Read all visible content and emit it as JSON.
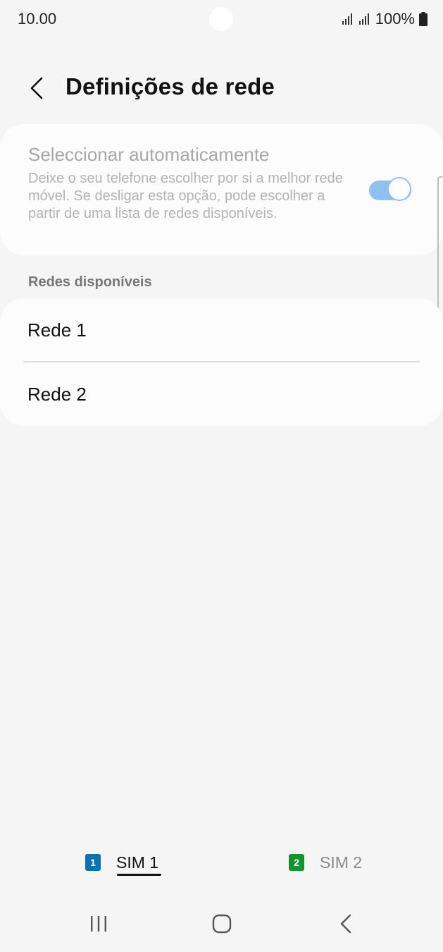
{
  "status_bar": {
    "time": "10.00",
    "battery": "100%"
  },
  "header": {
    "title": "Definições de rede"
  },
  "auto_select": {
    "title": "Seleccionar automaticamente",
    "description": "Deixe o seu telefone escolher por si a melhor rede móvel. Se desligar esta opção, pode escolher a partir de uma lista de redes disponíveis.",
    "toggle_on": true
  },
  "available_networks": {
    "label": "Redes disponíveis",
    "items": [
      {
        "label": "Rede 1"
      },
      {
        "label": "Rede 2"
      }
    ]
  },
  "sim_tabs": [
    {
      "badge": "1",
      "label": "SIM 1",
      "active": true,
      "badge_color": "#0b72b5"
    },
    {
      "badge": "2",
      "label": "SIM 2",
      "active": false,
      "badge_color": "#14942f"
    }
  ],
  "colors": {
    "background": "#f5f5f5",
    "card": "#fcfcfc",
    "toggle": "#8ec0f2"
  },
  "icons": {
    "back": "chevron-left-icon",
    "nav_recents": "recents-icon",
    "nav_home": "home-icon",
    "nav_back": "nav-back-icon"
  }
}
